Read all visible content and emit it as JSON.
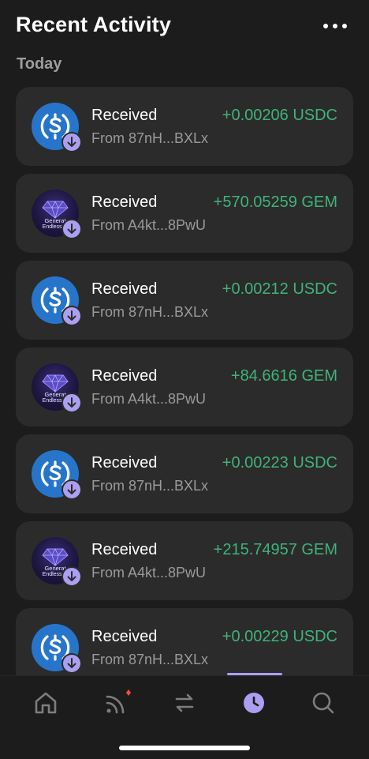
{
  "header": {
    "title": "Recent Activity"
  },
  "section": {
    "label": "Today"
  },
  "activities": [
    {
      "token": "usdc",
      "type": "Received",
      "from": "From 87nH...BXLx",
      "amount": "+0.00206 USDC"
    },
    {
      "token": "gem",
      "type": "Received",
      "from": "From A4kt...8PwU",
      "amount": "+570.05259 GEM",
      "logo_line1": "Generat",
      "logo_line2": "Endless M"
    },
    {
      "token": "usdc",
      "type": "Received",
      "from": "From 87nH...BXLx",
      "amount": "+0.00212 USDC"
    },
    {
      "token": "gem",
      "type": "Received",
      "from": "From A4kt...8PwU",
      "amount": "+84.6616 GEM",
      "logo_line1": "Generat",
      "logo_line2": "Endless M"
    },
    {
      "token": "usdc",
      "type": "Received",
      "from": "From 87nH...BXLx",
      "amount": "+0.00223 USDC"
    },
    {
      "token": "gem",
      "type": "Received",
      "from": "From A4kt...8PwU",
      "amount": "+215.74957 GEM",
      "logo_line1": "Generat",
      "logo_line2": "Endless M"
    },
    {
      "token": "usdc",
      "type": "Received",
      "from": "From 87nH...BXLx",
      "amount": "+0.00229 USDC"
    }
  ],
  "tabbar": {
    "items": [
      {
        "icon": "home-icon",
        "active": false
      },
      {
        "icon": "collectibles-icon",
        "active": false,
        "notification": true
      },
      {
        "icon": "swap-icon",
        "active": false
      },
      {
        "icon": "activity-clock-icon",
        "active": true
      },
      {
        "icon": "search-icon",
        "active": false
      }
    ]
  },
  "colors": {
    "background": "#1c1c1c",
    "card": "#2b2b2b",
    "positive": "#3fb37a",
    "accent": "#ab9ff2",
    "usdc": "#2775ca",
    "muted": "#9a9a9a"
  }
}
